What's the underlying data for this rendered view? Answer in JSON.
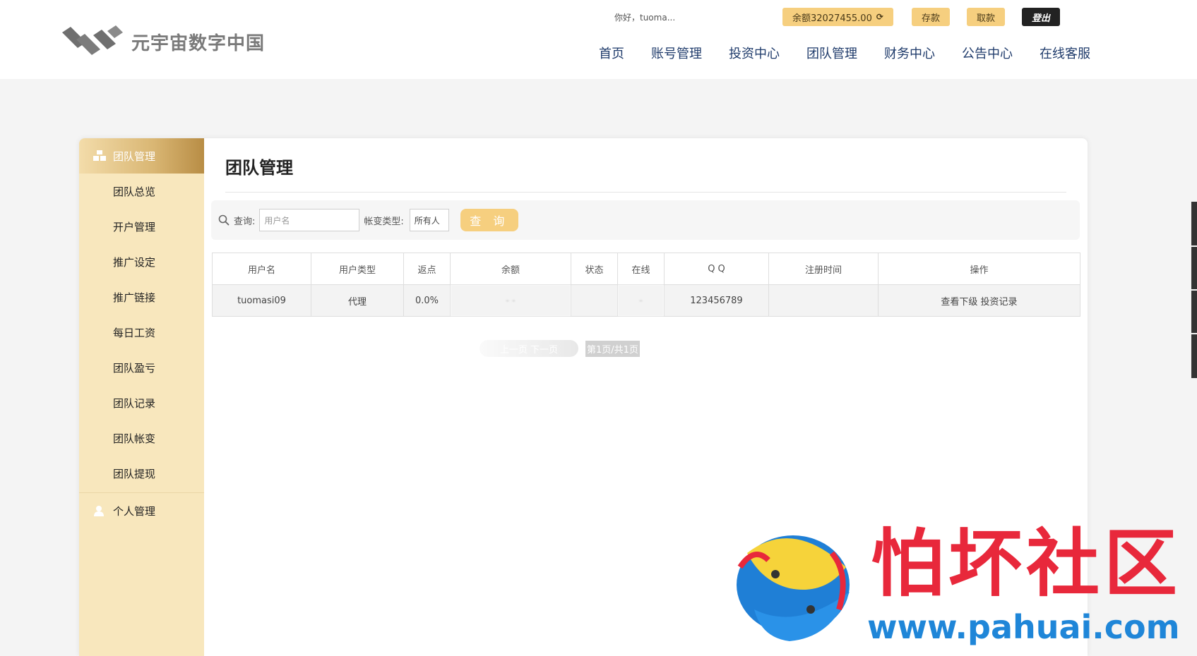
{
  "header": {
    "logo_text": "元宇宙数字中国",
    "greeting": "你好，tuoma...",
    "balance_label": "余额32027455.00",
    "deposit_label": "存款",
    "withdraw_label": "取款",
    "logout_label": "登出",
    "nav": [
      "首页",
      "账号管理",
      "投资中心",
      "团队管理",
      "财务中心",
      "公告中心",
      "在线客服"
    ]
  },
  "sidebar": {
    "section_title": "团队管理",
    "items": [
      "团队总览",
      "开户管理",
      "推广设定",
      "推广链接",
      "每日工资",
      "团队盈亏",
      "团队记录",
      "团队帐变",
      "团队提现"
    ],
    "personal_label": "个人管理"
  },
  "content": {
    "title": "团队管理",
    "search": {
      "query_label": "查询:",
      "username_placeholder": "用户名",
      "type_label": "帐变类型:",
      "type_value": "所有人",
      "button_label": "查 询"
    },
    "table": {
      "headers": [
        "用户名",
        "用户类型",
        "返点",
        "余额",
        "状态",
        "在线",
        "Q Q",
        "注册时间",
        "操作"
      ],
      "rows": [
        {
          "username": "tuomasi09",
          "type": "代理",
          "rebate": "0.0%",
          "balance": "- -",
          "status": "",
          "online": "-",
          "qq": "123456789",
          "reg_time": "",
          "actions": "查看下级 投资记录"
        }
      ]
    },
    "pager": {
      "faded_text": "上一页 下一页",
      "info": "第1页/共1页"
    }
  },
  "watermark": {
    "cn": "怕坏社区",
    "url": "www.pahuai.com"
  },
  "colors": {
    "accent": "#f6cf7f",
    "sidebar_bg": "#f8e7bd",
    "nav_text": "#1f3b6b"
  }
}
